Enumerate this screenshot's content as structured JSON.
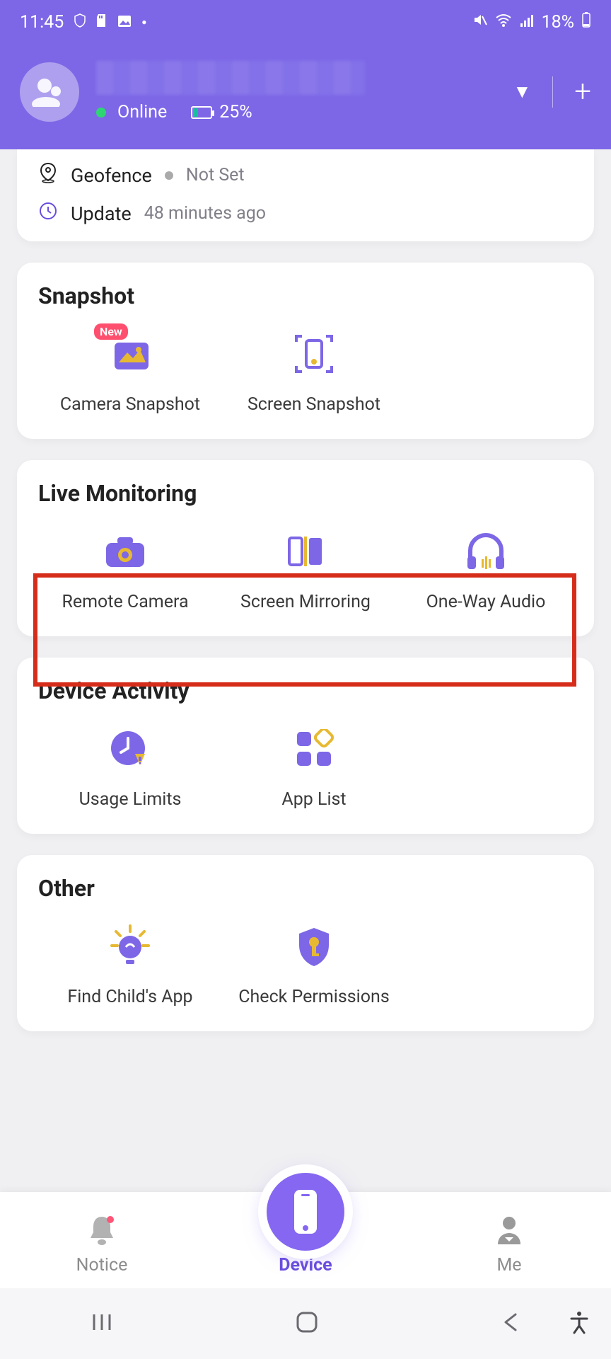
{
  "statusbar": {
    "time": "11:45",
    "battery_text": "18%"
  },
  "header": {
    "status_online": "Online",
    "device_battery": "25%"
  },
  "info_card": {
    "geofence_label": "Geofence",
    "geofence_value": "Not Set",
    "update_label": "Update",
    "update_value": "48 minutes ago"
  },
  "sections": {
    "snapshot": {
      "title": "Snapshot",
      "items": [
        "Camera Snapshot",
        "Screen Snapshot"
      ],
      "badge_new": "New"
    },
    "live": {
      "title": "Live Monitoring",
      "items": [
        "Remote Camera",
        "Screen Mirroring",
        "One-Way Audio"
      ]
    },
    "activity": {
      "title": "Device Activity",
      "items": [
        "Usage Limits",
        "App List"
      ]
    },
    "other": {
      "title": "Other",
      "items": [
        "Find Child's App",
        "Check Permissions"
      ]
    }
  },
  "bottom_nav": {
    "notice": "Notice",
    "device": "Device",
    "me": "Me"
  }
}
